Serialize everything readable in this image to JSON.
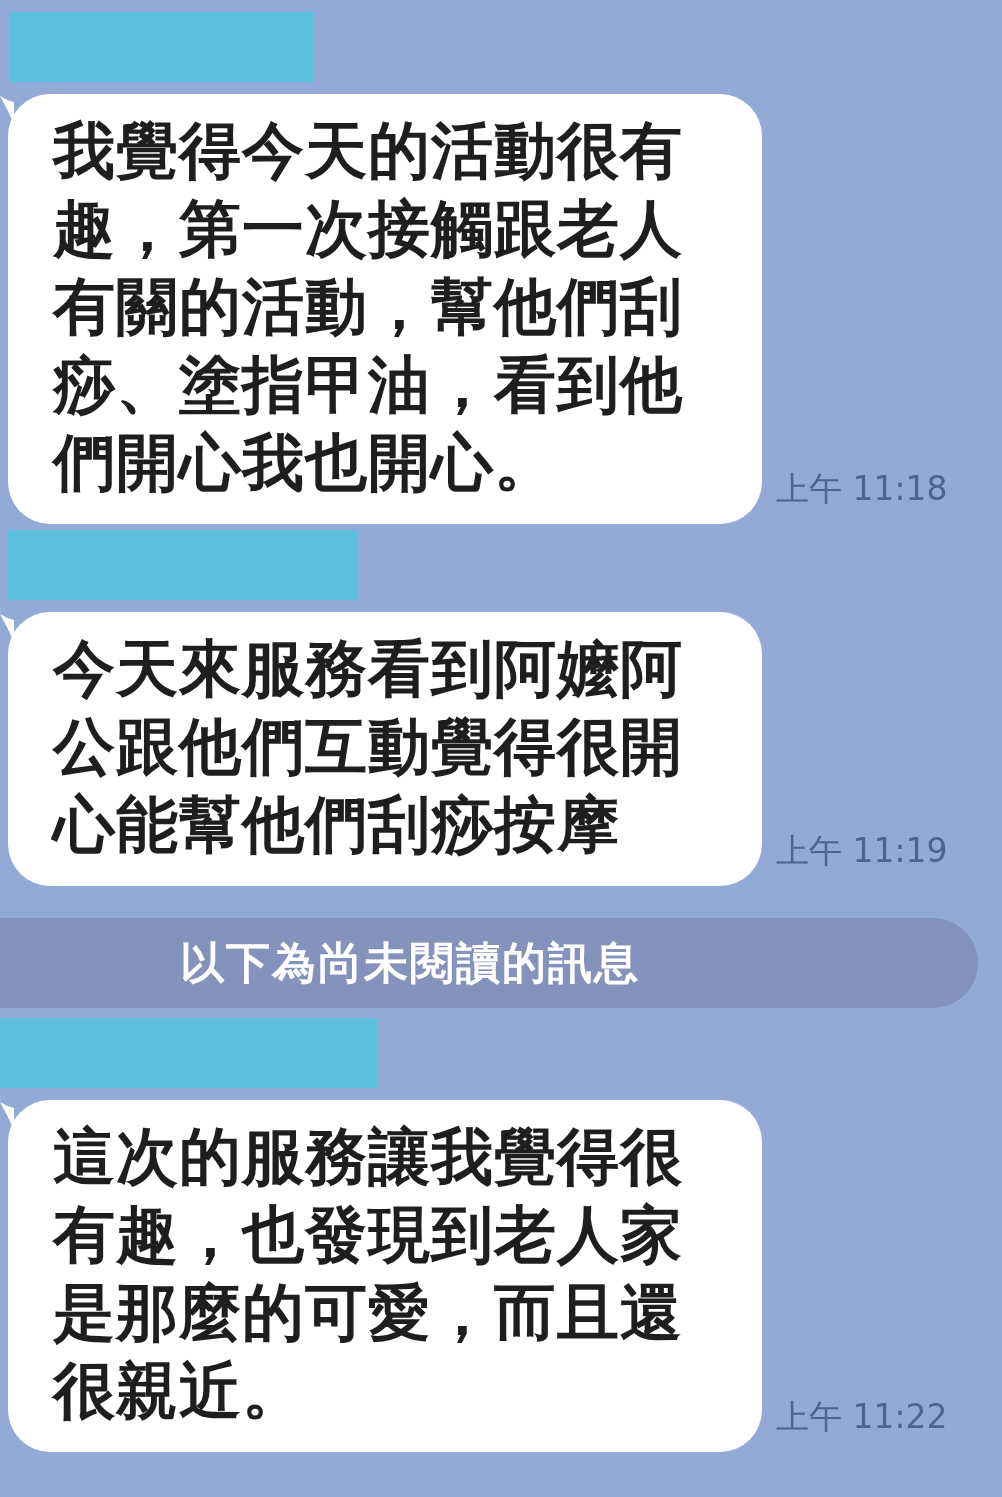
{
  "items": [
    {
      "kind": "redaction"
    },
    {
      "kind": "message",
      "text": "我覺得今天的活動很有趣，第一次接觸跟老人有關的活動，幫他們刮痧、塗指甲油，看到他們開心我也開心。",
      "time": "上午 11:18"
    },
    {
      "kind": "redaction"
    },
    {
      "kind": "message",
      "text": "今天來服務看到阿嬤阿公跟他們互動覺得很開心能幫他們刮痧按摩",
      "time": "上午 11:19"
    },
    {
      "kind": "divider",
      "text": "以下為尚未閱讀的訊息"
    },
    {
      "kind": "redaction"
    },
    {
      "kind": "message",
      "text": "這次的服務讓我覺得很有趣，也發現到老人家是那麼的可愛，而且還很親近。",
      "time": "上午 11:22"
    }
  ]
}
